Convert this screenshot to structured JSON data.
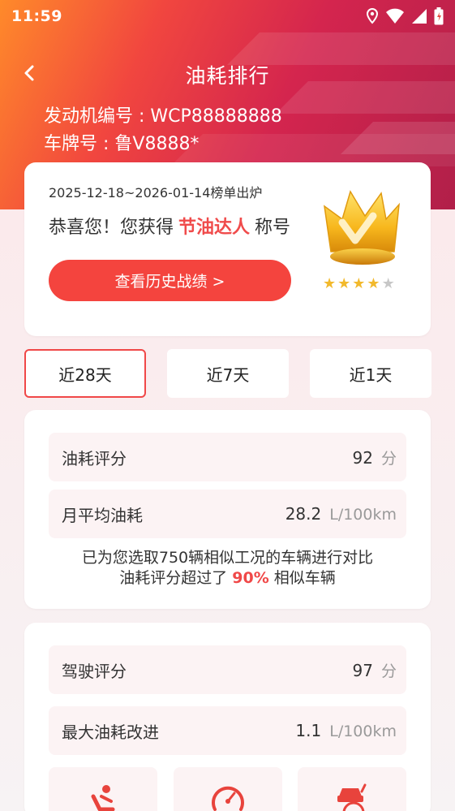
{
  "status_bar": {
    "time": "11:59"
  },
  "header": {
    "title": "油耗排行"
  },
  "vehicle": {
    "engine_line": "发动机编号 : WCP88888888",
    "plate_line": "车牌号 : 鲁V8888*"
  },
  "award": {
    "date_range": "2025-12-18~2026-01-14榜单出炉",
    "congrats_prefix": "恭喜您！您获得",
    "title_name": "节油达人",
    "congrats_suffix": "称号",
    "history_button": "查看历史战绩 >",
    "rating": 4,
    "rating_max": 5
  },
  "tabs": [
    {
      "label": "近28天",
      "active": true
    },
    {
      "label": "近7天",
      "active": false
    },
    {
      "label": "近1天",
      "active": false
    }
  ],
  "fuel_stats": {
    "score_label": "油耗评分",
    "score_value": "92",
    "score_unit": "分",
    "monthly_label": "月平均油耗",
    "monthly_value": "28.2",
    "monthly_unit": "L/100km",
    "compare_line1": "已为您选取750辆相似工况的车辆进行对比",
    "compare_line2_prefix": "油耗评分超过了",
    "compare_percent": "90%",
    "compare_line2_suffix": "相似车辆"
  },
  "driving_stats": {
    "score_label": "驾驶评分",
    "score_value": "97",
    "score_unit": "分",
    "improve_label": "最大油耗改进",
    "improve_value": "1.1",
    "improve_unit": "L/100km"
  },
  "icons": {
    "back": "chevron-left-icon",
    "location": "location-icon",
    "wifi": "wifi-icon",
    "signal": "cell-signal-icon",
    "battery": "battery-icon",
    "crown": "crown-badge-icon",
    "tile_1": "driver-seat-icon",
    "tile_2": "speedometer-icon",
    "tile_3": "car-speed-icon"
  },
  "colors": {
    "accent": "#f4443e",
    "highlight_text": "#f04b4b",
    "star_on": "#f2b92c",
    "star_off": "#c7c7c7"
  }
}
